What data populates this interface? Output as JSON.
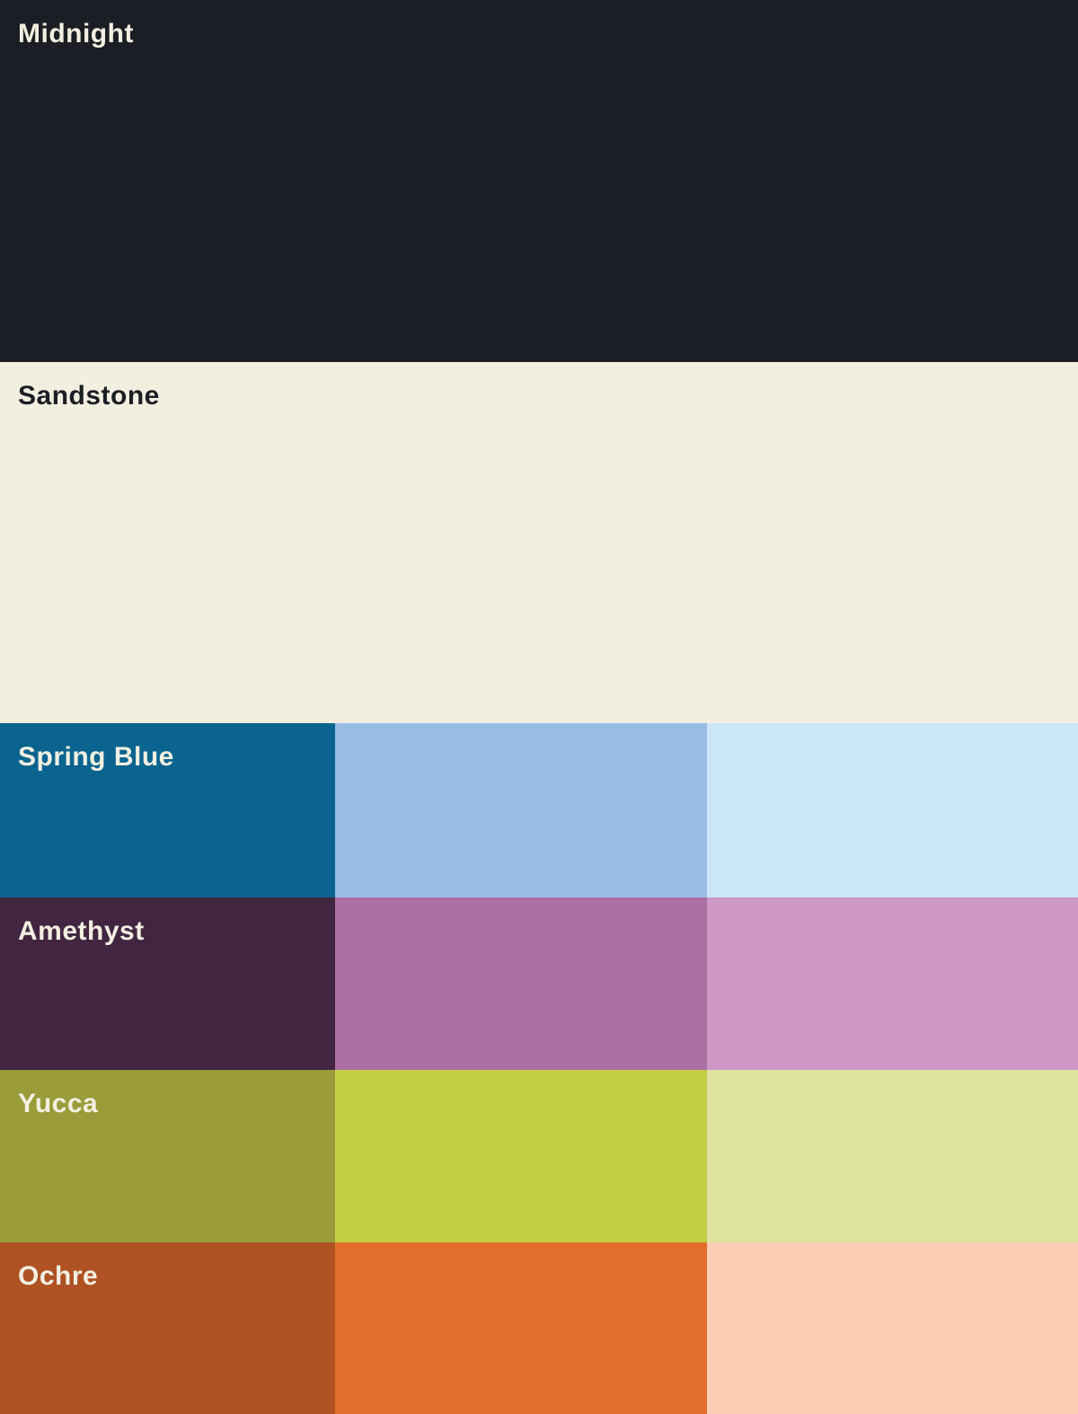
{
  "palette": {
    "sections": [
      {
        "name": "Midnight",
        "label": "Midnight",
        "type": "full",
        "color": "#1b1e24",
        "text_color": "#f2efe1"
      },
      {
        "name": "Sandstone",
        "label": "Sandstone",
        "type": "full",
        "color": "#f2efe1",
        "text_color": "#1b1e24"
      },
      {
        "name": "Spring Blue",
        "label": "Spring Blue",
        "type": "tints",
        "text_color": "#f2efe1",
        "shade_dark": "#0a648f",
        "shade_mid": "#9abde4",
        "shade_light": "#cbe6f8"
      },
      {
        "name": "Amethyst",
        "label": "Amethyst",
        "type": "tints",
        "text_color": "#f2efe1",
        "shade_dark": "#422540",
        "shade_mid": "#ad70a2",
        "shade_light": "#cd97c6"
      },
      {
        "name": "Yucca",
        "label": "Yucca",
        "type": "tints",
        "text_color": "#f2efe1",
        "shade_dark": "#999c39",
        "shade_mid": "#c5cf44",
        "shade_light": "#dfe3a0"
      },
      {
        "name": "Ochre",
        "label": "Ochre",
        "type": "tints",
        "text_color": "#f2efe1",
        "shade_dark": "#af5224",
        "shade_mid": "#e16e2c",
        "shade_light": "#fccdb4"
      }
    ]
  }
}
